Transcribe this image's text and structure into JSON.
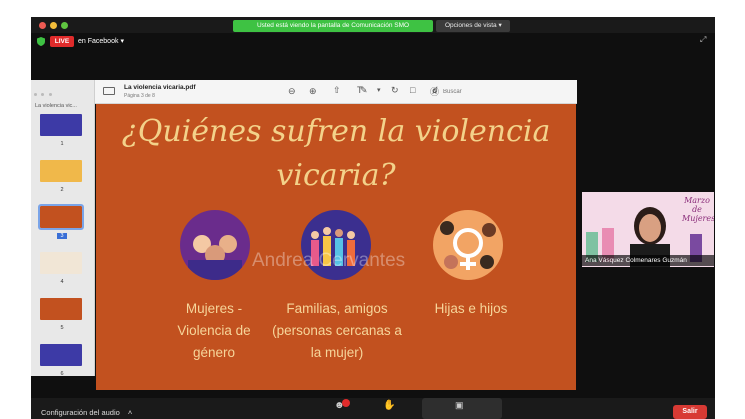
{
  "window": {
    "share_banner": "Usted está viendo la pantalla de Comunicación SMO",
    "view_options": "Opciones de vista"
  },
  "stream": {
    "live_badge": "LIVE",
    "destination": "en Facebook"
  },
  "viewer": {
    "file_name": "La violencia vicaria.pdf",
    "page_info": "Página 3 de 8",
    "search_placeholder": "Buscar",
    "sidebar_label": "La violencia vic...",
    "thumbs": [
      {
        "num": "1",
        "color": "#3d3aa6"
      },
      {
        "num": "2",
        "color": "#f0b84a"
      },
      {
        "num": "3",
        "color": "#c2511f"
      },
      {
        "num": "4",
        "color": "#f1e6d6"
      },
      {
        "num": "5",
        "color": "#c2511f"
      },
      {
        "num": "6",
        "color": "#3d3aa6"
      }
    ]
  },
  "slide": {
    "title_line1": "¿Quiénes sufren la violencia",
    "title_line2": "vicaria?",
    "watermark": "Andrea Cervantes",
    "captions": [
      "Mujeres - Violencia de género",
      "Familias, amigos (personas cercanas a la mujer)",
      "Hijas e hijos"
    ]
  },
  "participant": {
    "name": "Ana Vásquez Colmenares Guzmán",
    "background_title": "Marzo de Mujeres"
  },
  "controls": {
    "audio_settings": "Configuración del audio",
    "leave": "Salir"
  },
  "colors": {
    "slide_bg": "#c2511f",
    "slide_text": "#f3d28a",
    "banner_green": "#3ec243",
    "live_red": "#e02b2b"
  }
}
